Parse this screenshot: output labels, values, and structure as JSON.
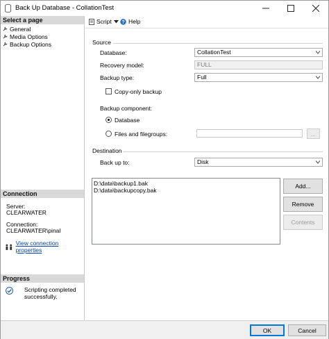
{
  "window": {
    "title": "Back Up Database - CollationTest"
  },
  "left": {
    "select_page_header": "Select a page",
    "pages": [
      {
        "label": "General"
      },
      {
        "label": "Media Options"
      },
      {
        "label": "Backup Options"
      }
    ],
    "connection_header": "Connection",
    "server_label": "Server:",
    "server_value": "CLEARWATER",
    "connection_label": "Connection:",
    "connection_value": "CLEARWATER\\pinal",
    "view_connection_link": "View connection properties",
    "progress_header": "Progress",
    "progress_status": "Scripting completed successfully."
  },
  "toolbar": {
    "script_label": "Script",
    "help_label": "Help"
  },
  "source": {
    "group_label": "Source",
    "database_label": "Database:",
    "database_value": "CollationTest",
    "recovery_model_label": "Recovery model:",
    "recovery_model_value": "FULL",
    "backup_type_label": "Backup type:",
    "backup_type_value": "Full",
    "copy_only_label": "Copy-only backup",
    "backup_component_label": "Backup component:",
    "component_database_label": "Database",
    "component_files_label": "Files and filegroups:",
    "browse_label": "..."
  },
  "destination": {
    "group_label": "Destination",
    "backup_to_label": "Back up to:",
    "backup_to_value": "Disk",
    "files": [
      "D:\\data\\backup1.bak",
      "D:\\data\\backupcopy.bak"
    ],
    "add_label": "Add...",
    "remove_label": "Remove",
    "contents_label": "Contents"
  },
  "footer": {
    "ok_label": "OK",
    "cancel_label": "Cancel"
  }
}
